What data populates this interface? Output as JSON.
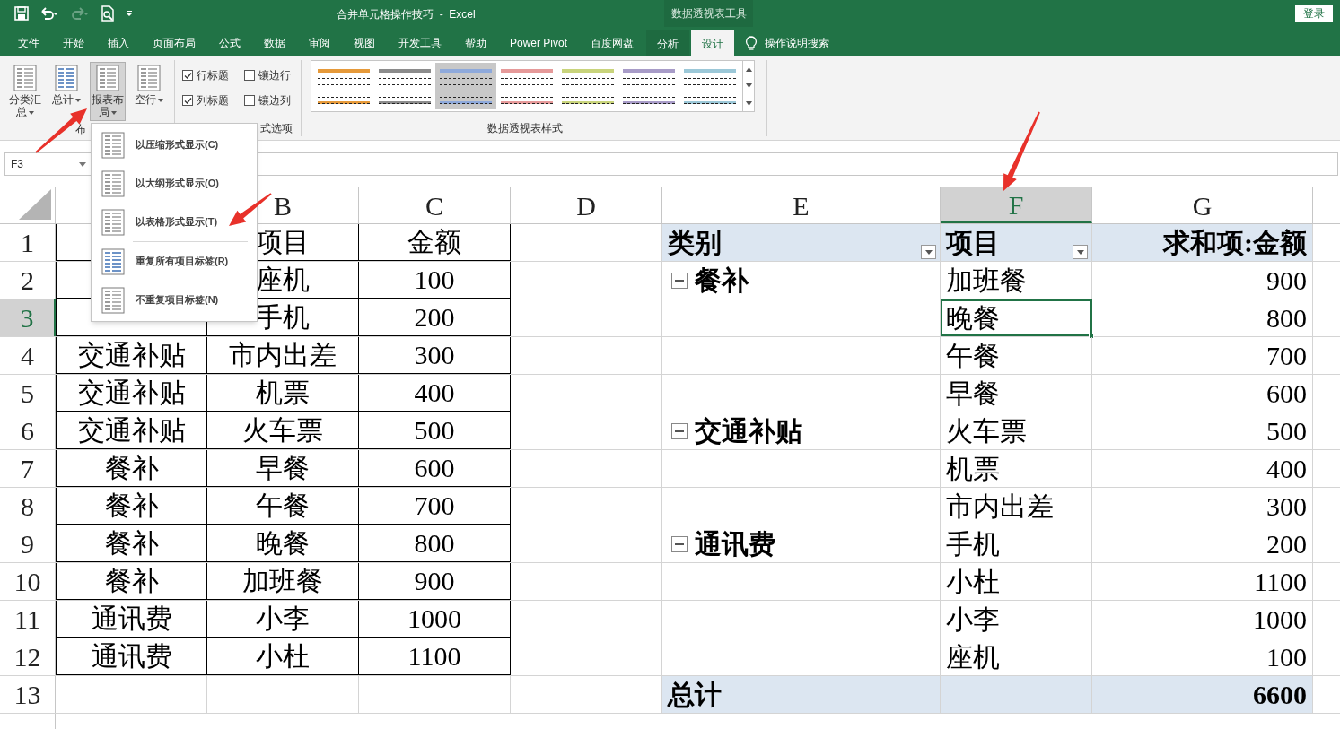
{
  "title_bar": {
    "title": "合并单元格操作技巧  -  Excel",
    "context_title": "数据透视表工具",
    "sign_in": "登录"
  },
  "menu_tabs": [
    {
      "label": "文件",
      "kind": "main",
      "selected": false
    },
    {
      "label": "开始",
      "kind": "main",
      "selected": false
    },
    {
      "label": "插入",
      "kind": "main",
      "selected": false
    },
    {
      "label": "页面布局",
      "kind": "main",
      "selected": false
    },
    {
      "label": "公式",
      "kind": "main",
      "selected": false
    },
    {
      "label": "数据",
      "kind": "main",
      "selected": false
    },
    {
      "label": "审阅",
      "kind": "main",
      "selected": false
    },
    {
      "label": "视图",
      "kind": "main",
      "selected": false
    },
    {
      "label": "开发工具",
      "kind": "main",
      "selected": false
    },
    {
      "label": "帮助",
      "kind": "main",
      "selected": false
    },
    {
      "label": "Power Pivot",
      "kind": "main",
      "selected": false
    },
    {
      "label": "百度网盘",
      "kind": "main",
      "selected": false
    },
    {
      "label": "分析",
      "kind": "contextual",
      "selected": false
    },
    {
      "label": "设计",
      "kind": "contextual",
      "selected": true
    }
  ],
  "tell_me": "操作说明搜索",
  "ribbon": {
    "layout_group": {
      "label": "布",
      "buttons": [
        {
          "label": "分类汇总",
          "pressed": false
        },
        {
          "label": "总计",
          "pressed": false
        },
        {
          "label": "报表布局",
          "pressed": true
        },
        {
          "label": "空行",
          "pressed": false
        }
      ]
    },
    "style_options": {
      "label": "式选项",
      "checkboxes": [
        {
          "label": "行标题",
          "checked": true
        },
        {
          "label": "镶边行",
          "checked": false
        },
        {
          "label": "列标题",
          "checked": true
        },
        {
          "label": "镶边列",
          "checked": false
        }
      ]
    },
    "styles": {
      "label": "数据透视表样式",
      "swatches": [
        {
          "color": "#e69a3a",
          "selected": false
        },
        {
          "color": "#8c8c8c",
          "selected": false
        },
        {
          "color": "#8ea9db",
          "selected": true
        },
        {
          "color": "#e69a9a",
          "selected": false
        },
        {
          "color": "#c9d47c",
          "selected": false
        },
        {
          "color": "#a89cc8",
          "selected": false
        },
        {
          "color": "#9cc8d8",
          "selected": false
        }
      ]
    }
  },
  "layout_menu": [
    {
      "label": "以压缩形式显示(C)",
      "divider_after": false
    },
    {
      "label": "以大纲形式显示(O)",
      "divider_after": false
    },
    {
      "label": "以表格形式显示(T)",
      "divider_after": true
    },
    {
      "label": "重复所有项目标签(R)",
      "divider_after": false
    },
    {
      "label": "不重复项目标签(N)",
      "divider_after": false
    }
  ],
  "name_box": "F3",
  "sheet": {
    "columns": [
      {
        "letter": "B",
        "selected": false
      },
      {
        "letter": "C",
        "selected": false
      },
      {
        "letter": "D",
        "selected": false
      },
      {
        "letter": "E",
        "selected": false
      },
      {
        "letter": "F",
        "selected": true
      },
      {
        "letter": "G",
        "selected": false
      }
    ],
    "rows": [
      {
        "number": "1",
        "kind": "pivot_header",
        "selected": false,
        "cells": {
          "B": "项目",
          "C": "金额",
          "E": "类别",
          "F": "项目",
          "G": "求和项:金额"
        }
      },
      {
        "number": "2",
        "kind": "data",
        "selected": false,
        "group_expanded": true,
        "cells": {
          "B": "座机",
          "C": "100",
          "E": "餐补",
          "F": "加班餐",
          "G": "900"
        }
      },
      {
        "number": "3",
        "kind": "data",
        "selected": true,
        "cells": {
          "B": "手机",
          "C": "200",
          "F": "晚餐",
          "G": "800"
        }
      },
      {
        "number": "4",
        "kind": "data",
        "selected": false,
        "cells": {
          "A": "交通补贴",
          "B": "市内出差",
          "C": "300",
          "F": "午餐",
          "G": "700"
        }
      },
      {
        "number": "5",
        "kind": "data",
        "selected": false,
        "cells": {
          "A": "交通补贴",
          "B": "机票",
          "C": "400",
          "F": "早餐",
          "G": "600"
        }
      },
      {
        "number": "6",
        "kind": "data",
        "selected": false,
        "group_expanded": true,
        "cells": {
          "A": "交通补贴",
          "B": "火车票",
          "C": "500",
          "E": "交通补贴",
          "F": "火车票",
          "G": "500"
        }
      },
      {
        "number": "7",
        "kind": "data",
        "selected": false,
        "cells": {
          "A": "餐补",
          "B": "早餐",
          "C": "600",
          "F": "机票",
          "G": "400"
        }
      },
      {
        "number": "8",
        "kind": "data",
        "selected": false,
        "cells": {
          "A": "餐补",
          "B": "午餐",
          "C": "700",
          "F": "市内出差",
          "G": "300"
        }
      },
      {
        "number": "9",
        "kind": "data",
        "selected": false,
        "group_expanded": true,
        "cells": {
          "A": "餐补",
          "B": "晚餐",
          "C": "800",
          "E": "通讯费",
          "F": "手机",
          "G": "200"
        }
      },
      {
        "number": "10",
        "kind": "data",
        "selected": false,
        "cells": {
          "A": "餐补",
          "B": "加班餐",
          "C": "900",
          "F": "小杜",
          "G": "1100"
        }
      },
      {
        "number": "11",
        "kind": "data",
        "selected": false,
        "cells": {
          "A": "通讯费",
          "B": "小李",
          "C": "1000",
          "F": "小李",
          "G": "1000"
        }
      },
      {
        "number": "12",
        "kind": "data",
        "selected": false,
        "cells": {
          "A": "通讯费",
          "B": "小杜",
          "C": "1100",
          "F": "座机",
          "G": "100"
        }
      },
      {
        "number": "13",
        "kind": "pivot_total",
        "selected": false,
        "cells": {
          "E": "总计",
          "G": "6600"
        }
      }
    ]
  }
}
